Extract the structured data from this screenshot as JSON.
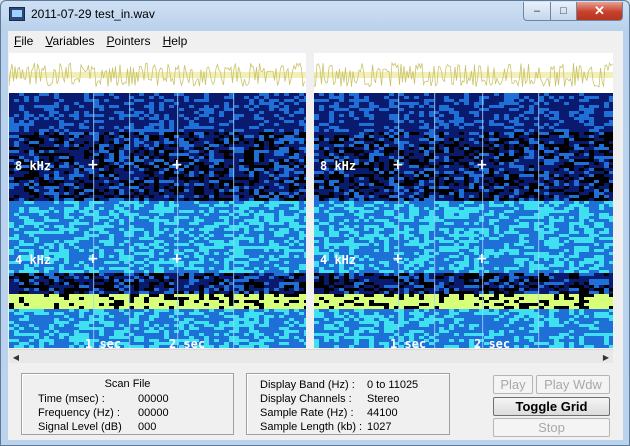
{
  "window": {
    "title": "2011-07-29 test_in.wav",
    "controls": {
      "minimize": "–",
      "maximize": "□",
      "close": "✕"
    }
  },
  "menu": [
    {
      "label": "File",
      "underline": "F",
      "rest": "ile"
    },
    {
      "label": "Variables",
      "underline": "V",
      "rest": "ariables"
    },
    {
      "label": "Pointers",
      "underline": "P",
      "rest": "ointers"
    },
    {
      "label": "Help",
      "underline": "H",
      "rest": "elp"
    }
  ],
  "spectrogram": {
    "freq_labels": [
      "8 kHz",
      "4 kHz"
    ],
    "time_labels": [
      "1 sec",
      "2 sec"
    ],
    "colors": {
      "background": "#000000",
      "low": "#0a1a6e",
      "mid": "#1e6fd6",
      "high": "#3fe0f0",
      "peak": "#d8ff7a"
    }
  },
  "scan": {
    "title": "Scan File",
    "time_label": "Time (msec) :",
    "time_value": "00000",
    "freq_label": "Frequency (Hz) :",
    "freq_value": "00000",
    "level_label": "Signal Level (dB)",
    "level_value": "000"
  },
  "display": {
    "band_label": "Display Band (Hz) :",
    "band_value": "0 to 11025",
    "channels_label": "Display Channels :",
    "channels_value": "Stereo",
    "rate_label": "Sample Rate (Hz) :",
    "rate_value": "44100",
    "length_label": "Sample Length (kb) :",
    "length_value": "1027"
  },
  "buttons": {
    "play": "Play",
    "play_wdw": "Play Wdw",
    "toggle_grid": "Toggle Grid",
    "stop": "Stop"
  },
  "scrollbar": {
    "left": "◀",
    "right": "▶"
  }
}
